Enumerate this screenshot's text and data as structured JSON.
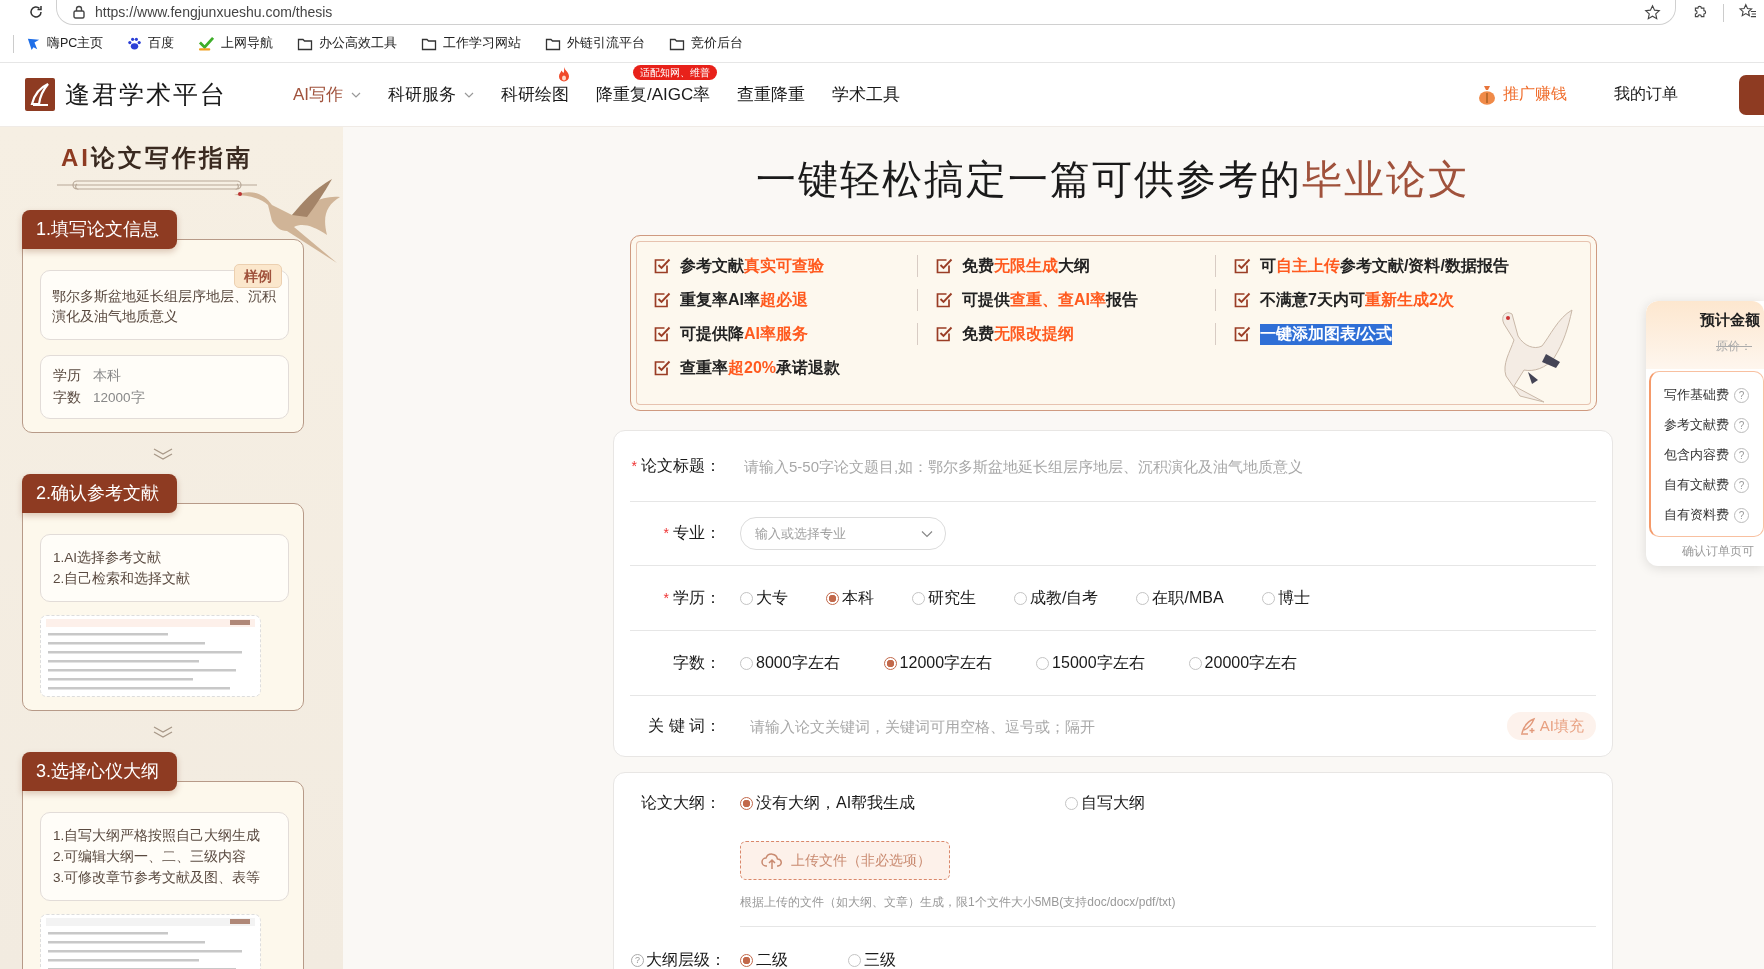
{
  "browser": {
    "url": "https://www.fengjunxueshu.com/thesis",
    "bookmarks": [
      {
        "label": "嗨PC主页",
        "kind": "hai"
      },
      {
        "label": "百度",
        "kind": "paw"
      },
      {
        "label": "上网导航",
        "kind": "hao"
      },
      {
        "label": "办公高效工具",
        "kind": "folder"
      },
      {
        "label": "工作学习网站",
        "kind": "folder"
      },
      {
        "label": "外链引流平台",
        "kind": "folder"
      },
      {
        "label": "竞价后台",
        "kind": "folder"
      }
    ]
  },
  "header": {
    "logo": "逢君学术平台",
    "nav": [
      {
        "label": "AI写作",
        "selected": true,
        "dropdown": true
      },
      {
        "label": "科研服务",
        "selected": false,
        "dropdown": true
      },
      {
        "label": "科研绘图",
        "selected": false,
        "dropdown": false,
        "hot": true
      },
      {
        "label": "降重复/AIGC率",
        "selected": false,
        "dropdown": false,
        "badge": "适配知网、维普"
      },
      {
        "label": "查重降重",
        "selected": false,
        "dropdown": false
      },
      {
        "label": "学术工具",
        "selected": false,
        "dropdown": false
      }
    ],
    "promo": "推广赚钱",
    "orders": "我的订单"
  },
  "guide": {
    "title": "**AI**论文写作指南",
    "steps": [
      {
        "kind": "info",
        "title": "1.填写论文信息",
        "tag": "样例",
        "sample": "鄂尔多斯盆地延长组层序地层、沉积演化及油气地质意义",
        "facts": [
          {
            "label": "学历",
            "value": "本科"
          },
          {
            "label": "字数",
            "value": "12000字"
          }
        ]
      },
      {
        "kind": "list",
        "title": "2.确认参考文献",
        "lines": [
          "1.AI选择参考文献",
          "2.自己检索和选择文献"
        ]
      },
      {
        "kind": "list",
        "title": "3.选择心仪大纲",
        "lines": [
          "1.自写大纲严格按照自己大纲生成",
          "2.可编辑大纲一、二、三级内容",
          "3.可修改章节参考文献及图、表等"
        ]
      }
    ]
  },
  "headline": [
    {
      "text": "一键轻松搞定一篇可供参考的",
      "accent": false
    },
    {
      "text": "毕业论文",
      "accent": true
    }
  ],
  "features": [
    {
      "highlighted": false,
      "segments": [
        {
          "text": "参考文献",
          "accent": false
        },
        {
          "text": "真实可查验",
          "accent": true
        }
      ]
    },
    {
      "highlighted": false,
      "segments": [
        {
          "text": "免费",
          "accent": false
        },
        {
          "text": "无限生成",
          "accent": true
        },
        {
          "text": "大纲",
          "accent": false
        }
      ]
    },
    {
      "highlighted": false,
      "segments": [
        {
          "text": "可",
          "accent": false
        },
        {
          "text": "自主上传",
          "accent": true
        },
        {
          "text": "参考文献/资料/数据报告",
          "accent": false
        }
      ]
    },
    {
      "highlighted": false,
      "segments": [
        {
          "text": "重复率AI率",
          "accent": false
        },
        {
          "text": "超必退",
          "accent": true
        }
      ]
    },
    {
      "highlighted": false,
      "segments": [
        {
          "text": "可提供",
          "accent": false
        },
        {
          "text": "查重、查AI率",
          "accent": true
        },
        {
          "text": "报告",
          "accent": false
        }
      ]
    },
    {
      "highlighted": false,
      "segments": [
        {
          "text": "不满意7天内可",
          "accent": false
        },
        {
          "text": "重新生成2次",
          "accent": true
        }
      ]
    },
    {
      "highlighted": false,
      "segments": [
        {
          "text": "可提供降",
          "accent": false
        },
        {
          "text": "AI率服务",
          "accent": true
        }
      ]
    },
    {
      "highlighted": false,
      "segments": [
        {
          "text": "免费",
          "accent": false
        },
        {
          "text": "无限改提纲",
          "accent": true
        }
      ]
    },
    {
      "highlighted": true,
      "segments": [
        {
          "text": "一键添加图表/公式",
          "accent": false
        }
      ]
    },
    {
      "highlighted": false,
      "segments": [
        {
          "text": "查重率",
          "accent": false
        },
        {
          "text": "超20%",
          "accent": true
        },
        {
          "text": "承诺退款",
          "accent": false
        }
      ]
    }
  ],
  "form": {
    "fields": [
      {
        "kind": "text",
        "mark": "*",
        "label": "论文标题：",
        "placeholder": "请输入5-50字论文题目,如：鄂尔多斯盆地延长组层序地层、沉积演化及油气地质意义"
      },
      {
        "kind": "select",
        "mark": "*",
        "label": "专业：",
        "placeholder": "输入或选择专业"
      },
      {
        "kind": "radio",
        "mark": "*",
        "label": "学历：",
        "options": [
          {
            "label": "大专",
            "selected": false
          },
          {
            "label": "本科",
            "selected": true
          },
          {
            "label": "研究生",
            "selected": false
          },
          {
            "label": "成教/自考",
            "selected": false
          },
          {
            "label": "在职/MBA",
            "selected": false
          },
          {
            "label": "博士",
            "selected": false
          }
        ]
      },
      {
        "kind": "radio",
        "label": "字数：",
        "options": [
          {
            "label": "8000字左右",
            "selected": false
          },
          {
            "label": "12000字左右",
            "selected": true
          },
          {
            "label": "15000字左右",
            "selected": false
          },
          {
            "label": "20000字左右",
            "selected": false
          }
        ]
      },
      {
        "kind": "keywords",
        "label": "关 键 词：",
        "placeholder": "请输入论文关键词，关键词可用空格、逗号或；隔开",
        "button": "AI填充"
      }
    ]
  },
  "outline": {
    "label": "论文大纲：",
    "options": [
      {
        "label": "没有大纲，AI帮我生成",
        "selected": true
      },
      {
        "label": "自写大纲",
        "selected": false
      }
    ],
    "upload": "上传文件（非必选项）",
    "hint": "根据上传的文件（如大纲、文章）生成，限1个文件大小5MB(支持doc/docx/pdf/txt)",
    "level_help": "?",
    "level_label": "大纲层级：",
    "levels": [
      {
        "label": "二级",
        "selected": true
      },
      {
        "label": "三级",
        "selected": false
      }
    ]
  },
  "estimate": {
    "title": "预计金额",
    "original_price": "原价：",
    "fees": [
      {
        "label": "写作基础费",
        "help": "?"
      },
      {
        "label": "参考文献费",
        "help": "?"
      },
      {
        "label": "包含内容费",
        "help": "?"
      },
      {
        "label": "自有文献费",
        "help": "?"
      },
      {
        "label": "自有资料费",
        "help": "?"
      }
    ],
    "note": "确认订单页可"
  }
}
